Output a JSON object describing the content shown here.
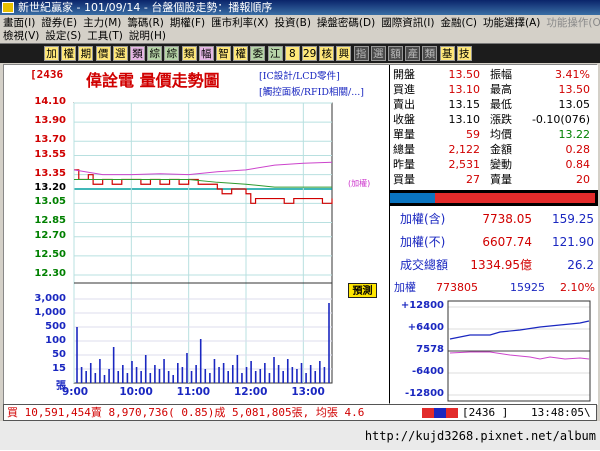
{
  "window": {
    "title": "新世紀贏家 - 101/09/14 - 台盤個股走勢：播報順序"
  },
  "menu": {
    "row1": [
      {
        "label": "畫面(I)",
        "enabled": true
      },
      {
        "label": "證券(E)",
        "enabled": true
      },
      {
        "label": "主力(M)",
        "enabled": true
      },
      {
        "label": "籌碼(R)",
        "enabled": true
      },
      {
        "label": "期權(F)",
        "enabled": true
      },
      {
        "label": "匯市利率(X)",
        "enabled": true
      },
      {
        "label": "投資(B)",
        "enabled": true
      },
      {
        "label": "操盤密碼(D)",
        "enabled": true
      },
      {
        "label": "國際資訊(I)",
        "enabled": true
      },
      {
        "label": "金融(C)",
        "enabled": true
      },
      {
        "label": "功能選擇(A)",
        "enabled": true
      },
      {
        "label": "功能操作(O)",
        "enabled": false
      }
    ],
    "row2": [
      {
        "label": "檢視(V)",
        "enabled": true
      },
      {
        "label": "設定(S)",
        "enabled": true
      },
      {
        "label": "工具(T)",
        "enabled": true
      },
      {
        "label": "說明(H)",
        "enabled": true
      }
    ]
  },
  "toolbar": [
    "加",
    "權",
    "期",
    "價",
    "選",
    "類",
    "綜",
    "綜",
    "類",
    "幅",
    "智",
    "權",
    "委",
    "江",
    "8",
    "29",
    "核",
    "興",
    "指",
    "選",
    "額",
    "產",
    "類",
    "基",
    "技"
  ],
  "chart": {
    "stock_code": "[2436",
    "title": "偉詮電  量價走勢圖",
    "concepts": [
      "[IC設計/LCD零件]",
      "[觸控面板/RFID相關/...]"
    ],
    "weighted_tag": "(加權)",
    "forecast_button": "預測",
    "price_ticks": [
      "14.10",
      "13.90",
      "13.70",
      "13.55",
      "13.35",
      "13.20",
      "13.05",
      "12.85",
      "12.70",
      "12.50",
      "12.30"
    ],
    "volume_ticks": [
      "3,000",
      "1,000",
      "500",
      "100",
      "50",
      "15",
      "張"
    ],
    "time_ticks": [
      "9:00",
      "10:00",
      "11:00",
      "12:00",
      "13:00"
    ]
  },
  "chart_data": {
    "type": "line",
    "title": "偉詮電  量價走勢圖",
    "reference_price": 13.2,
    "ylim": [
      12.3,
      14.1
    ],
    "xlim": [
      "9:00",
      "13:30"
    ],
    "series": [
      {
        "color": "#d00000",
        "style": "step",
        "points": [
          [
            "9:00",
            13.4
          ],
          [
            "9:05",
            13.3
          ],
          [
            "9:10",
            13.3
          ],
          [
            "9:15",
            13.35
          ],
          [
            "9:20",
            13.25
          ],
          [
            "9:30",
            13.3
          ],
          [
            "9:40",
            13.25
          ],
          [
            "9:50",
            13.3
          ],
          [
            "10:00",
            13.3
          ],
          [
            "10:10",
            13.25
          ],
          [
            "10:20",
            13.3
          ],
          [
            "10:30",
            13.25
          ],
          [
            "10:40",
            13.3
          ],
          [
            "10:50",
            13.25
          ],
          [
            "11:00",
            13.3
          ],
          [
            "11:10",
            13.25
          ],
          [
            "11:20",
            13.25
          ],
          [
            "11:30",
            13.2
          ],
          [
            "11:35",
            13.15
          ],
          [
            "11:45",
            13.2
          ],
          [
            "12:00",
            13.15
          ],
          [
            "12:05",
            13.05
          ],
          [
            "12:10",
            13.1
          ],
          [
            "12:20",
            13.1
          ],
          [
            "12:30",
            13.1
          ],
          [
            "12:40",
            13.05
          ],
          [
            "12:50",
            13.1
          ],
          [
            "13:00",
            13.1
          ],
          [
            "13:10",
            13.1
          ],
          [
            "13:20",
            13.05
          ],
          [
            "13:30",
            13.1
          ]
        ]
      },
      {
        "color": "#2e9b2e",
        "style": "smooth",
        "points": [
          [
            "9:00",
            13.3
          ],
          [
            "10:00",
            13.3
          ],
          [
            "11:00",
            13.3
          ],
          [
            "11:30",
            13.27
          ],
          [
            "12:00",
            13.25
          ],
          [
            "12:30",
            13.22
          ],
          [
            "13:00",
            13.22
          ],
          [
            "13:30",
            13.22
          ]
        ]
      },
      {
        "color": "#cc44cc",
        "style": "smooth",
        "points": [
          [
            "9:00",
            13.4
          ],
          [
            "9:30",
            13.35
          ],
          [
            "10:00",
            13.35
          ],
          [
            "10:30",
            13.36
          ],
          [
            "11:00",
            13.35
          ],
          [
            "11:30",
            13.38
          ],
          [
            "12:00",
            13.4
          ],
          [
            "12:30",
            13.45
          ],
          [
            "13:00",
            13.47
          ],
          [
            "13:30",
            13.48
          ]
        ]
      }
    ],
    "volume": {
      "ylabel": "張",
      "values": [
        28,
        8,
        6,
        10,
        5,
        12,
        4,
        7,
        18,
        6,
        9,
        5,
        11,
        8,
        6,
        14,
        5,
        9,
        7,
        12,
        6,
        4,
        10,
        8,
        15,
        6,
        9,
        22,
        7,
        5,
        12,
        8,
        10,
        6,
        9,
        14,
        5,
        8,
        11,
        6,
        7,
        10,
        5,
        13,
        9,
        6,
        12,
        8,
        7,
        10,
        5,
        9,
        6,
        11,
        8,
        40
      ]
    }
  },
  "quote": {
    "rows": [
      {
        "k1": "開盤",
        "v1": "13.50",
        "c1": "red",
        "k2": "振幅",
        "v2": "3.41%",
        "c2": "red"
      },
      {
        "k1": "買進",
        "v1": "13.10",
        "c1": "red",
        "k2": "最高",
        "v2": "13.50",
        "c2": "red"
      },
      {
        "k1": "賣出",
        "v1": "13.15",
        "c1": "black",
        "k2": "最低",
        "v2": "13.05",
        "c2": "black"
      },
      {
        "k1": "收盤",
        "v1": "13.10",
        "c1": "black",
        "k2": "漲跌",
        "v2": "-0.10(076)",
        "c2": "black"
      },
      {
        "k1": "單量",
        "v1": "59",
        "c1": "red",
        "k2": "均價",
        "v2": "13.22",
        "c2": "green"
      },
      {
        "k1": "總量",
        "v1": "2,122",
        "c1": "red",
        "k2": "金額",
        "v2": "0.28",
        "c2": "red"
      },
      {
        "k1": "昨量",
        "v1": "2,531",
        "c1": "red",
        "k2": "變動",
        "v2": "0.84",
        "c2": "red"
      },
      {
        "k1": "買量",
        "v1": "27",
        "c1": "red",
        "k2": "賣量",
        "v2": "20",
        "c2": "red"
      }
    ],
    "index_rows": [
      {
        "k": "加權(含)",
        "v": "7738.05",
        "c": "159.25"
      },
      {
        "k": "加權(不)",
        "v": "6607.74",
        "c": "121.90"
      },
      {
        "k": "成交總額",
        "v": "1334.95億",
        "c": "26.2"
      }
    ],
    "mini": {
      "label": "加權",
      "value": "773805",
      "change": "15925",
      "pct": "2.10%",
      "ticks": [
        "+12800",
        "+6400",
        "7578",
        "-6400",
        "-12800"
      ]
    }
  },
  "status": {
    "summary": "買 10,591,454賣 8,970,736( 0.85)成 5,081,805張, 均張 4.6",
    "code": "[2436   ]",
    "time": "13:48:05\\"
  },
  "footer": {
    "url": "http://kujd3268.pixnet.net/album"
  }
}
